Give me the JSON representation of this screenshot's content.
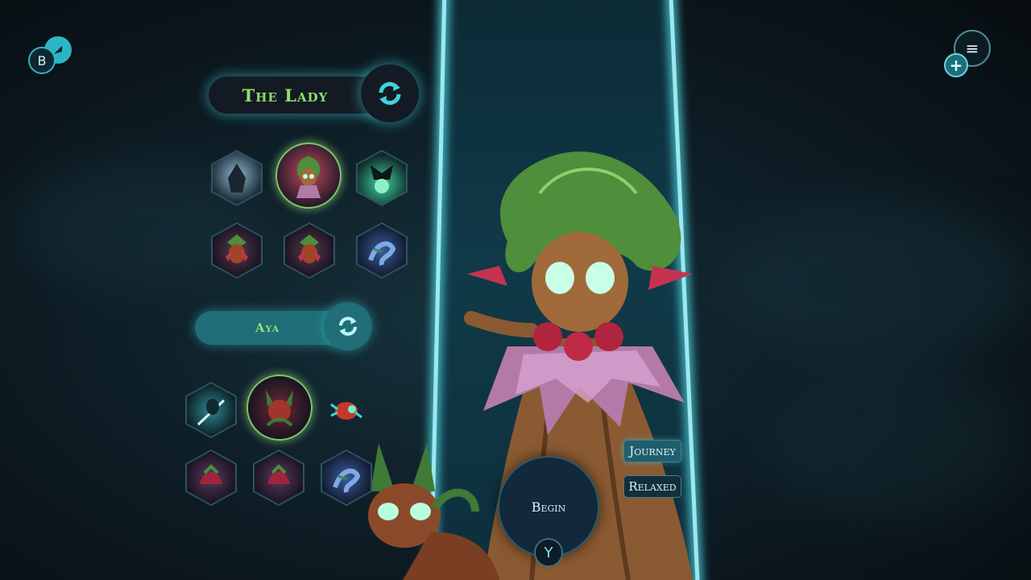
{
  "hud": {
    "top_left_primary_letter": "B",
    "top_right_menu_glyph": "≡",
    "top_right_add_glyph": "+"
  },
  "character_panel": {
    "title": "The Lady",
    "swap_glyph": "⟳",
    "portraits": [
      {
        "name": "shadow-wraith",
        "color": "#5a7a8f"
      },
      {
        "name": "the-lady-selected",
        "color": "#8a3346"
      },
      {
        "name": "glowing-orb-spirit",
        "color": "#2a7a6a"
      },
      {
        "name": "berry-sprite",
        "color": "#7a2c40"
      },
      {
        "name": "berry-sprite-alt",
        "color": "#7a2c48"
      },
      {
        "name": "blue-serpent",
        "color": "#3a5e9a"
      }
    ]
  },
  "companion_panel": {
    "title": "Aya",
    "swap_glyph": "⟳",
    "portraits": [
      {
        "name": "spear-hunter",
        "color": "#2f6a74"
      },
      {
        "name": "aya-selected",
        "color": "#6a2a3a"
      },
      {
        "name": "red-critter",
        "color": "#8a3a2a"
      },
      {
        "name": "crimson-beast",
        "color": "#7a2c48"
      },
      {
        "name": "crimson-beast-alt",
        "color": "#7a2c40"
      },
      {
        "name": "blue-serpent",
        "color": "#3a5e9a"
      }
    ]
  },
  "mode": {
    "journey_label": "Journey",
    "relaxed_label": "Relaxed"
  },
  "begin": {
    "label": "Begin",
    "controller_hint": "Y"
  },
  "colors": {
    "accent_green": "#8fe06a",
    "accent_cyan": "#3fd3dd",
    "panel_dark": "#141a24",
    "pill_teal": "#1f6e78"
  }
}
